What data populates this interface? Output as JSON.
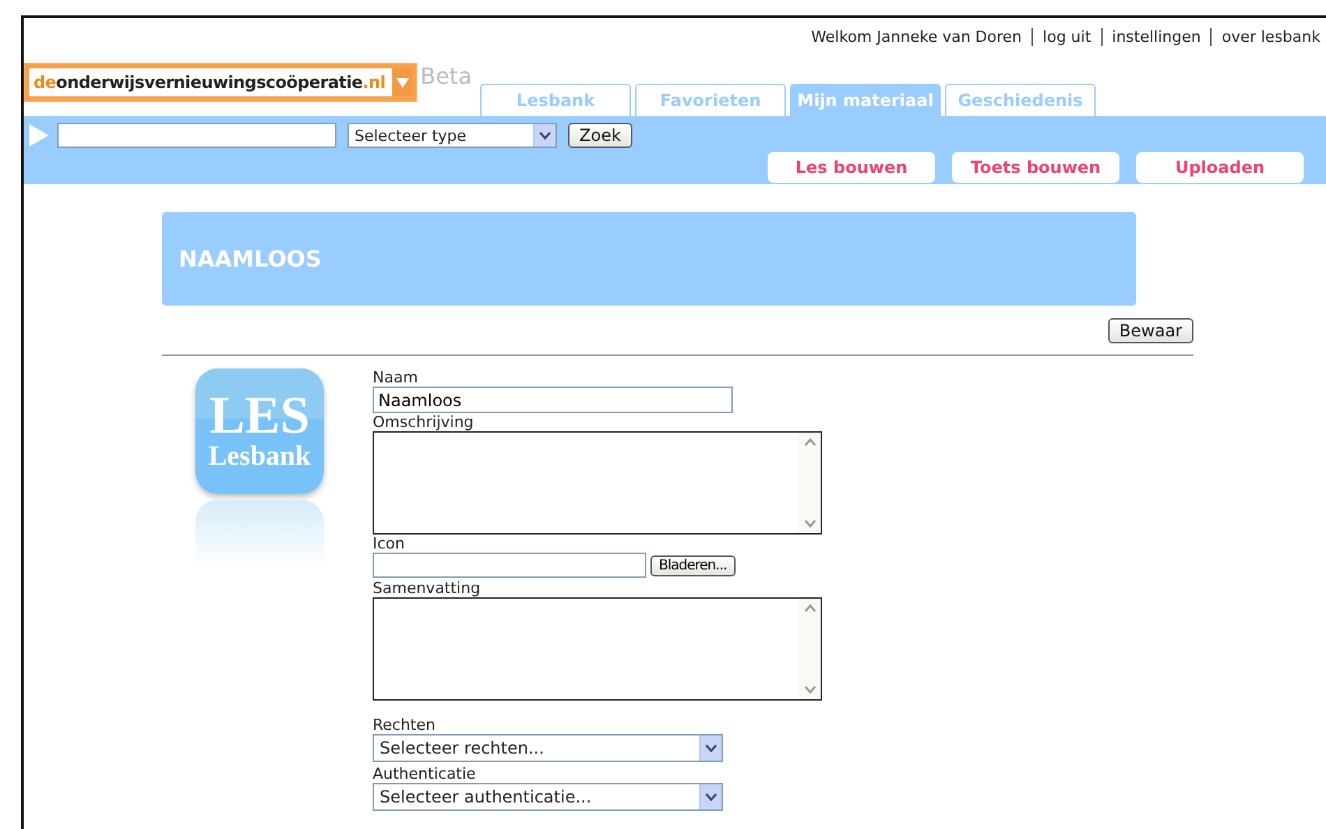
{
  "top_links": [
    "Welkom Janneke van Doren",
    "log uit",
    "instellingen",
    "over lesbank"
  ],
  "logo": {
    "prefix": "de",
    "name": "onderwijsvernieuwingscoöperatie",
    "suffix": ".nl",
    "badge": "Beta"
  },
  "tabs": [
    {
      "label": "Lesbank",
      "selected": false
    },
    {
      "label": "Favorieten",
      "selected": false
    },
    {
      "label": "Mijn materiaal",
      "selected": true
    },
    {
      "label": "Geschiedenis",
      "selected": false
    }
  ],
  "search": {
    "type_select": "Selecteer type",
    "button": "Zoek"
  },
  "actions": [
    "Les bouwen",
    "Toets bouwen",
    "Uploaden"
  ],
  "page_title": "NAAMLOOS",
  "save_button": "Bewaar",
  "icon_preview": {
    "title": "LES",
    "subtitle": "Lesbank"
  },
  "form": [
    {
      "kind": "input",
      "label": "Naam",
      "value": "Naamloos"
    },
    {
      "kind": "textarea",
      "label": "Omschrijving"
    },
    {
      "kind": "file",
      "label": "Icon",
      "button": "Bladeren..."
    },
    {
      "kind": "textarea",
      "label": "Samenvatting"
    },
    {
      "kind": "select",
      "label": "Rechten",
      "value": "Selecteer rechten..."
    },
    {
      "kind": "select",
      "label": "Authenticatie",
      "value": "Selecteer authenticatie..."
    }
  ]
}
